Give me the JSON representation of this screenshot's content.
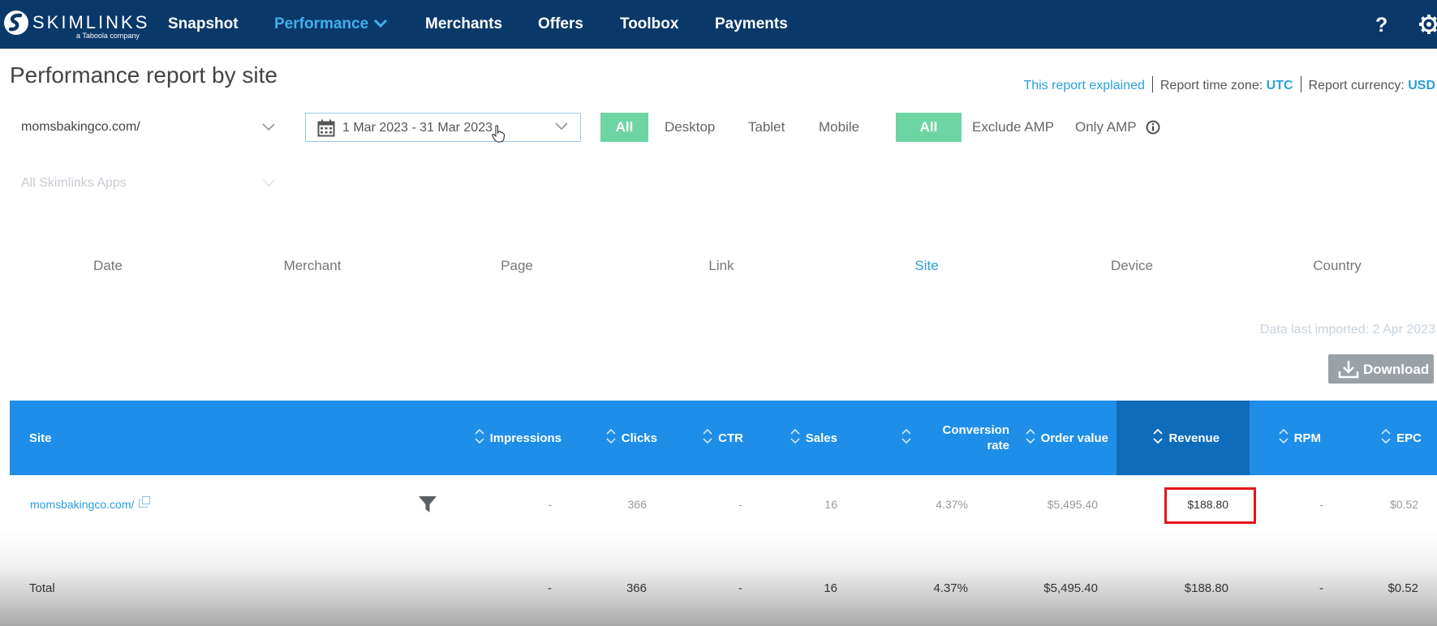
{
  "brand": {
    "name": "SKIMLINKS",
    "tagline": "a Taboola company"
  },
  "nav": {
    "items": [
      {
        "label": "Snapshot"
      },
      {
        "label": "Performance"
      },
      {
        "label": "Merchants"
      },
      {
        "label": "Offers"
      },
      {
        "label": "Toolbox"
      },
      {
        "label": "Payments"
      }
    ],
    "active": "Performance",
    "help_icon": "question-icon",
    "settings_icon": "gear-icon"
  },
  "page": {
    "title": "Performance report by site",
    "explained_link": "This report explained",
    "timezone_label": "Report time zone:",
    "timezone": "UTC",
    "currency_label": "Report currency:",
    "currency": "USD"
  },
  "filters": {
    "site": "momsbakingco.com/",
    "apps_placeholder": "All Skimlinks Apps",
    "date_range": "1 Mar 2023 - 31 Mar 2023",
    "device": [
      "All",
      "Desktop",
      "Tablet",
      "Mobile"
    ],
    "device_selected": "All",
    "amp": [
      "All",
      "Exclude AMP",
      "Only AMP"
    ],
    "amp_selected": "All"
  },
  "dimensions": {
    "tabs": [
      "Date",
      "Merchant",
      "Page",
      "Link",
      "Site",
      "Device",
      "Country"
    ],
    "active": "Site"
  },
  "data_imported": "Data last imported: 2 Apr 2023",
  "download_label": "Download",
  "table": {
    "columns": {
      "site": "Site",
      "impressions": "Impressions",
      "clicks": "Clicks",
      "ctr": "CTR",
      "sales": "Sales",
      "conversion_rate_1": "Conversion",
      "conversion_rate_2": "rate",
      "order_value": "Order value",
      "revenue": "Revenue",
      "rpm": "RPM",
      "epc": "EPC"
    },
    "row": {
      "site": "momsbakingco.com/",
      "impressions": "-",
      "clicks": "366",
      "ctr": "-",
      "sales": "16",
      "conversion_rate": "4.37%",
      "order_value": "$5,495.40",
      "revenue": "$188.80",
      "rpm": "-",
      "epc": "$0.52"
    },
    "total": {
      "label": "Total",
      "impressions": "-",
      "clicks": "366",
      "ctr": "-",
      "sales": "16",
      "conversion_rate": "4.37%",
      "order_value": "$5,495.40",
      "revenue": "$188.80",
      "rpm": "-",
      "epc": "$0.52"
    }
  },
  "colors": {
    "nav_bg": "#0a3869",
    "accent": "#2a9fde",
    "toggle_on": "#6dd4a4",
    "table_header": "#1e8ee8",
    "table_header_sorted": "#0f6cba",
    "highlight_box": "#e3151a"
  }
}
